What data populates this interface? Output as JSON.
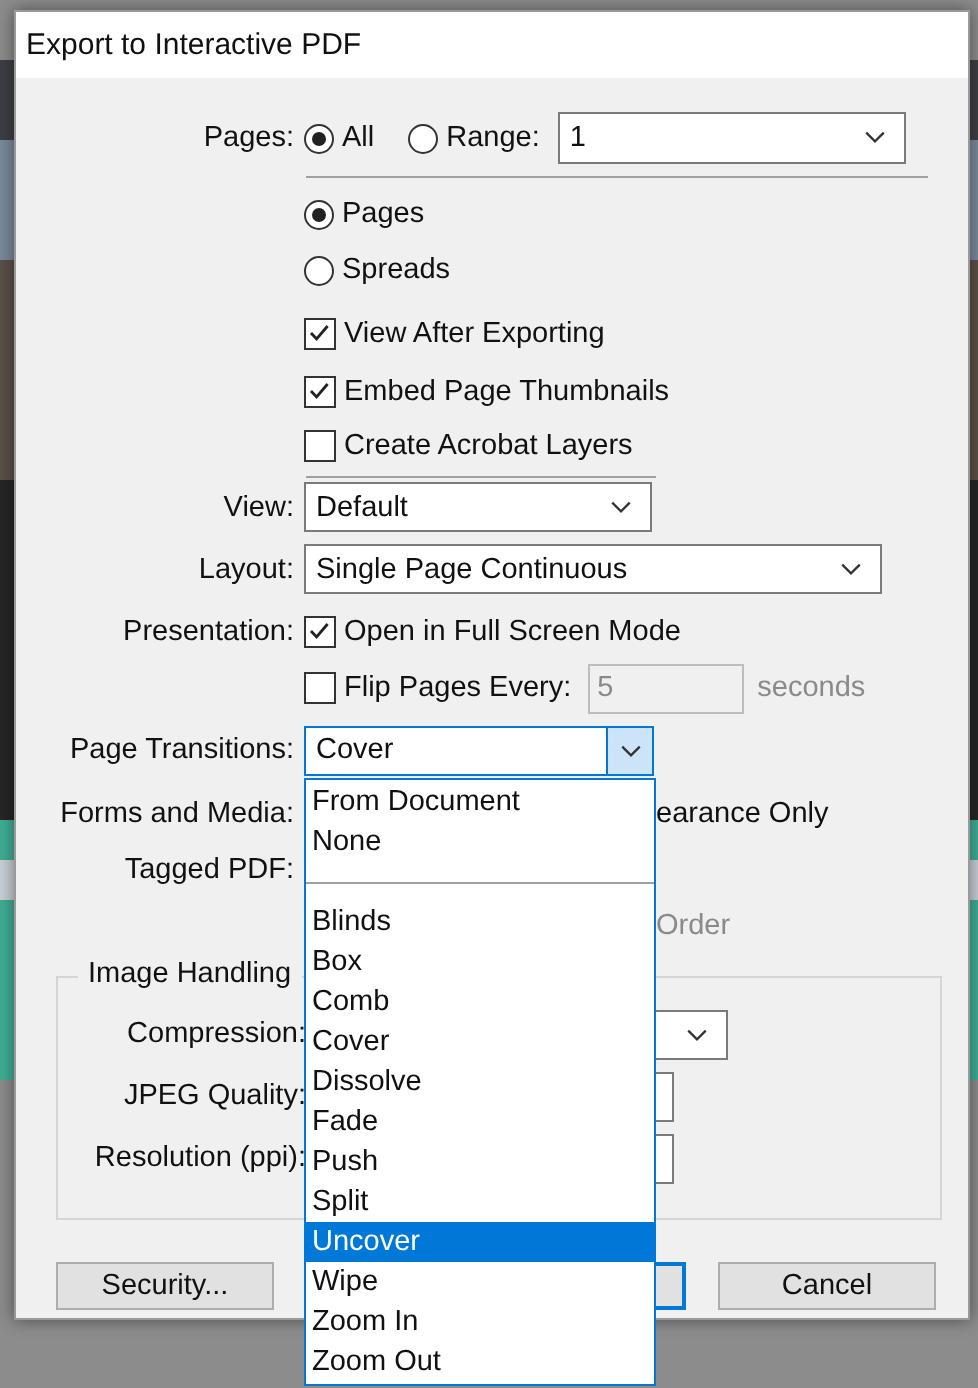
{
  "window": {
    "title": "Export to Interactive PDF"
  },
  "pages": {
    "label": "Pages:",
    "options": [
      {
        "label": "All",
        "selected": true
      },
      {
        "label": "Range:",
        "selected": false
      }
    ],
    "range_value": "1"
  },
  "page_mode": [
    {
      "label": "Pages",
      "selected": true
    },
    {
      "label": "Spreads",
      "selected": false
    }
  ],
  "options": [
    {
      "label": "View After Exporting",
      "checked": true
    },
    {
      "label": "Embed Page Thumbnails",
      "checked": true
    },
    {
      "label": "Create Acrobat Layers",
      "checked": false
    }
  ],
  "view": {
    "label": "View:",
    "value": "Default"
  },
  "layout": {
    "label": "Layout:",
    "value": "Single Page Continuous"
  },
  "presentation": {
    "label": "Presentation:",
    "full_screen": {
      "label": "Open in Full Screen Mode",
      "checked": true
    },
    "flip_pages": {
      "label": "Flip Pages Every:",
      "checked": false,
      "value": "5",
      "unit": "seconds"
    }
  },
  "page_transitions": {
    "label": "Page Transitions:",
    "value": "Cover",
    "expanded": true,
    "items": [
      {
        "kind": "option",
        "label": "From Document",
        "highlighted": false
      },
      {
        "kind": "option",
        "label": "None",
        "highlighted": false
      },
      {
        "kind": "separator"
      },
      {
        "kind": "option",
        "label": "Blinds",
        "highlighted": false
      },
      {
        "kind": "option",
        "label": "Box",
        "highlighted": false
      },
      {
        "kind": "option",
        "label": "Comb",
        "highlighted": false
      },
      {
        "kind": "option",
        "label": "Cover",
        "highlighted": false
      },
      {
        "kind": "option",
        "label": "Dissolve",
        "highlighted": false
      },
      {
        "kind": "option",
        "label": "Fade",
        "highlighted": false
      },
      {
        "kind": "option",
        "label": "Push",
        "highlighted": false
      },
      {
        "kind": "option",
        "label": "Split",
        "highlighted": false
      },
      {
        "kind": "option",
        "label": "Uncover",
        "highlighted": true
      },
      {
        "kind": "option",
        "label": "Wipe",
        "highlighted": false
      },
      {
        "kind": "option",
        "label": "Zoom In",
        "highlighted": false
      },
      {
        "kind": "option",
        "label": "Zoom Out",
        "highlighted": false
      }
    ]
  },
  "forms_and_media": {
    "label": "Forms and Media:",
    "option_text": "earance Only"
  },
  "tagged_pdf": {
    "label": "Tagged PDF:",
    "option_text": "Order",
    "disabled": true
  },
  "image_handling": {
    "title": "Image Handling",
    "fields": [
      {
        "label": "Compression:"
      },
      {
        "label": "JPEG Quality:"
      },
      {
        "label": "Resolution (ppi):"
      }
    ]
  },
  "buttons": [
    {
      "label": "Security..."
    },
    {
      "label": "Cancel"
    }
  ]
}
